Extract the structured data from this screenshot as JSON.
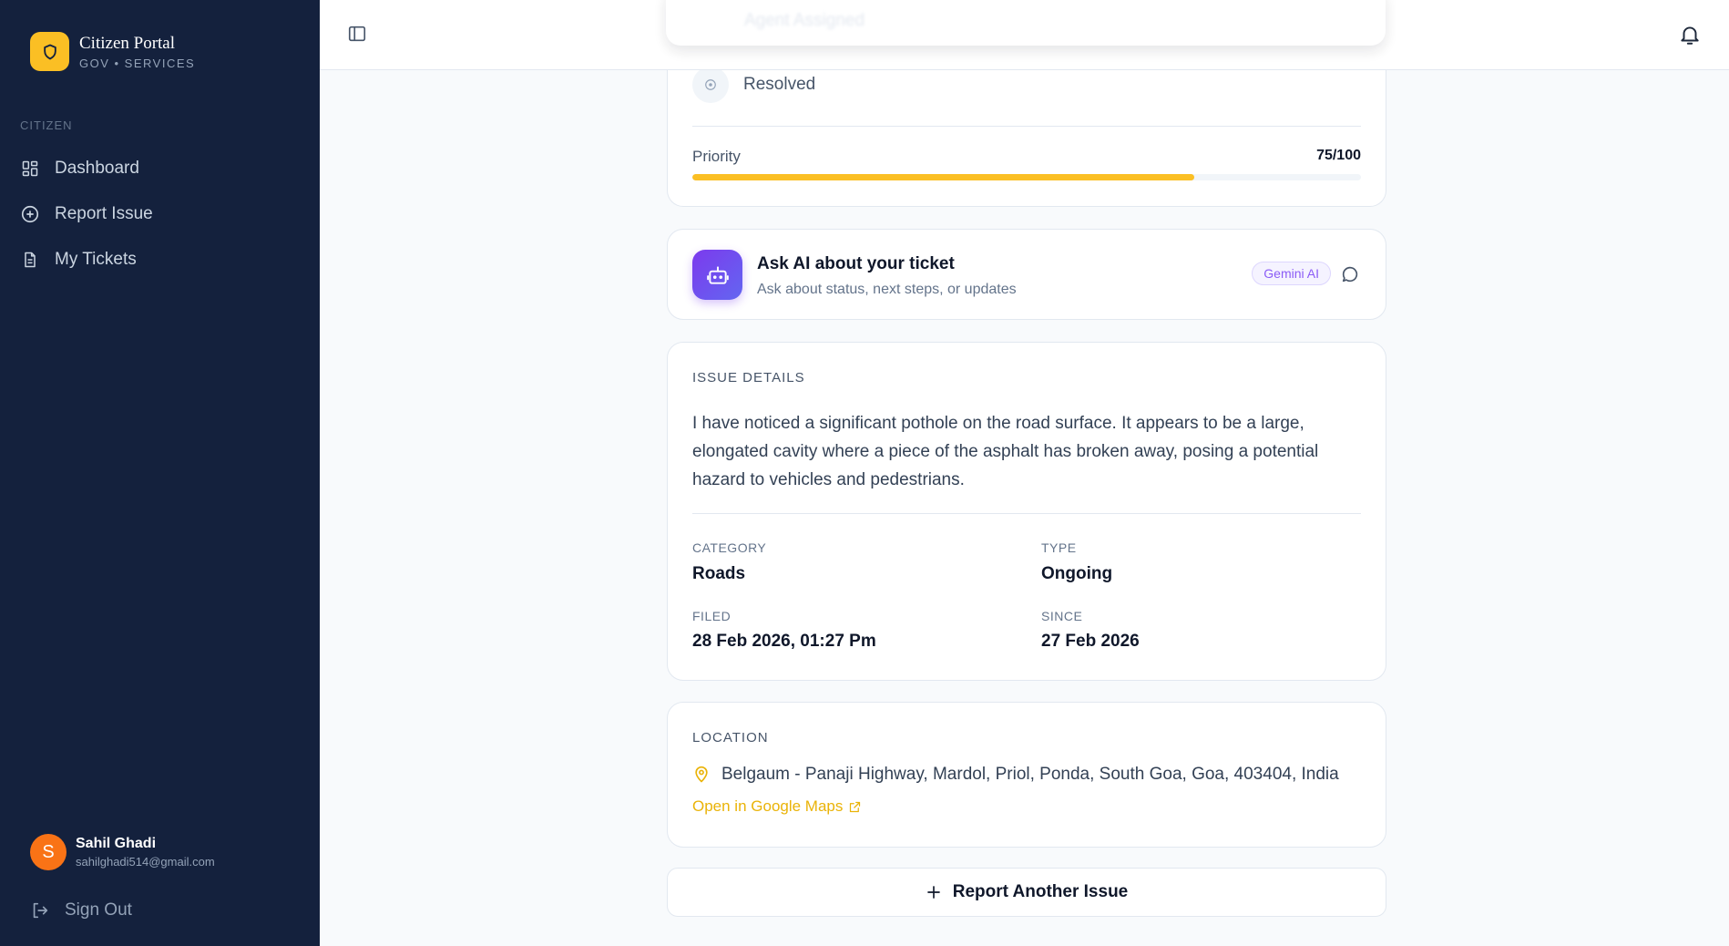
{
  "brand": {
    "title": "Citizen Portal",
    "subtitle": "GOV • SERVICES",
    "icon": "shield-icon"
  },
  "sidebar": {
    "section": "CITIZEN",
    "items": [
      {
        "label": "Dashboard",
        "icon": "grid-icon"
      },
      {
        "label": "Report Issue",
        "icon": "plus-circle-icon"
      },
      {
        "label": "My Tickets",
        "icon": "file-icon"
      }
    ],
    "user": {
      "initial": "S",
      "name": "Sahil Ghadi",
      "email": "sahilghadi514@gmail.com"
    },
    "signout": "Sign Out"
  },
  "topbar": {
    "toggle_icon": "sidebar-toggle-icon",
    "bell_icon": "bell-icon",
    "ghost_label": "Agent Assigned"
  },
  "status": {
    "step_label": "Resolved",
    "priority_label": "Priority",
    "priority_value": "75/100",
    "priority_fraction": 0.75
  },
  "ai": {
    "title": "Ask AI about your ticket",
    "subtitle": "Ask about status, next steps, or updates",
    "badge": "Gemini AI"
  },
  "details": {
    "section_title": "ISSUE DETAILS",
    "description": "I have noticed a significant pothole on the road surface. It appears to be a large, elongated cavity where a piece of the asphalt has broken away, posing a potential hazard to vehicles and pedestrians.",
    "category_label": "CATEGORY",
    "category_value": "Roads",
    "type_label": "TYPE",
    "type_value": "Ongoing",
    "filed_label": "FILED",
    "filed_value": "28 Feb 2026, 01:27 Pm",
    "since_label": "SINCE",
    "since_value": "27 Feb 2026"
  },
  "location": {
    "section_title": "LOCATION",
    "address": "Belgaum - Panaji Highway, Mardol, Priol, Ponda, South Goa, Goa, 403404, India",
    "maps_link": "Open in Google Maps"
  },
  "actions": {
    "report_another": "Report Another Issue"
  },
  "colors": {
    "sidebar_bg": "#14213d",
    "accent": "#fbbf24",
    "ai_purple": "#7c3aed",
    "avatar": "#f97316"
  }
}
